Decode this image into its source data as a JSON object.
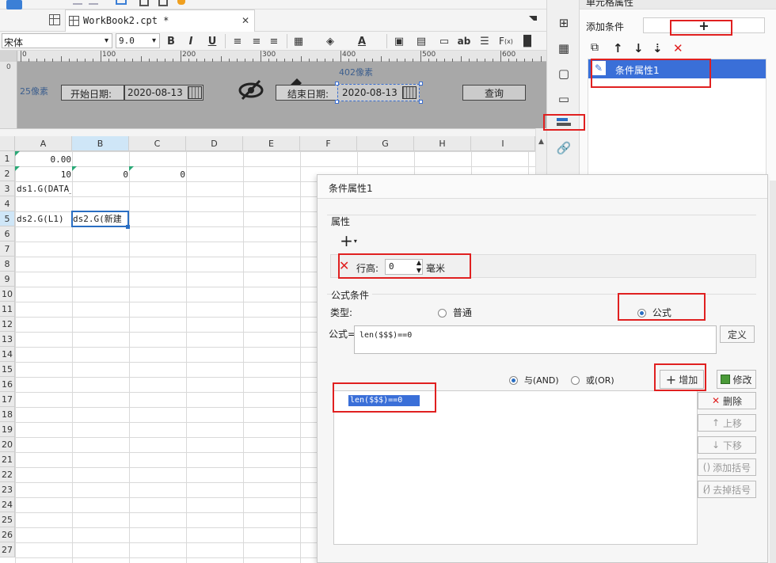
{
  "tab": {
    "title": "WorkBook2.cpt *",
    "close": "✕"
  },
  "font": {
    "name": "宋体",
    "size": "9.0"
  },
  "ruler": {
    "ticks": [
      "0",
      "100",
      "200",
      "300",
      "400",
      "500",
      "600"
    ],
    "side": "0"
  },
  "param_panel": {
    "size_left": "25像素",
    "size_width": "402像素",
    "start_label": "开始日期:",
    "start_value": "2020-08-13",
    "end_label": "结束日期:",
    "end_value": "2020-08-13",
    "query_button": "查询"
  },
  "sheet": {
    "columns": [
      "A",
      "B",
      "C",
      "D",
      "E",
      "F",
      "G",
      "H",
      "I"
    ],
    "rows": [
      "1",
      "2",
      "3",
      "4",
      "5",
      "6",
      "7",
      "8",
      "9",
      "10",
      "11",
      "12",
      "13",
      "14",
      "15",
      "16",
      "17",
      "18",
      "19",
      "20",
      "21",
      "22",
      "23",
      "24",
      "25",
      "26",
      "27"
    ],
    "cells": {
      "a1": "0.00",
      "a2": "10",
      "b2": "0",
      "c2": "0",
      "a3": "ds1.G(DATA_",
      "a5": "ds2.G(L1)",
      "b5": "ds2.G(新建"
    }
  },
  "right_panel": {
    "title": "单元格属性",
    "add_condition_label": "添加条件",
    "add_button": "+",
    "list": [
      {
        "label": "条件属性1"
      }
    ]
  },
  "dialog": {
    "title": "条件属性1",
    "attribute_group": "属性",
    "add_attr_button": "+",
    "row_height_label": "行高:",
    "row_height_value": "0",
    "row_height_unit": "毫米",
    "formula_group": "公式条件",
    "type_label": "类型:",
    "type_normal": "普通",
    "type_formula": "公式",
    "formula_label": "公式=",
    "formula_value": "len($$$)==0",
    "define_button": "定义",
    "and_label": "与(AND)",
    "or_label": "或(OR)",
    "add_button": "增加",
    "modify_button": "修改",
    "delete_button": "删除",
    "move_up_button": "上移",
    "move_down_button": "下移",
    "add_bracket_button": "添加括号",
    "remove_bracket_button": "去掉括号",
    "conditions": [
      "len($$$)==0"
    ]
  },
  "colors": {
    "accent": "#3b8ad9",
    "highlight": "#e02020",
    "selected": "#3a6fd8"
  }
}
